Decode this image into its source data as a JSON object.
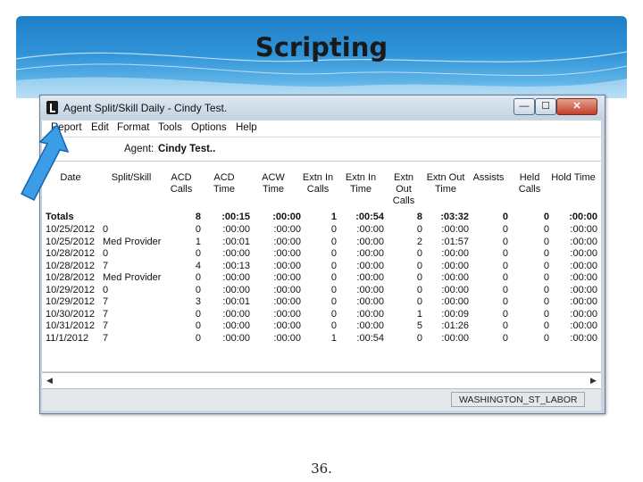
{
  "slide": {
    "title": "Scripting",
    "page_number": "36."
  },
  "window": {
    "title": "Agent Split/Skill Daily - Cindy Test.",
    "buttons": {
      "minimize": "—",
      "maximize": "☐",
      "close": "✕"
    }
  },
  "menu": [
    "Report",
    "Edit",
    "Format",
    "Tools",
    "Options",
    "Help"
  ],
  "agent": {
    "label": "Agent:",
    "value": "Cindy Test.."
  },
  "table": {
    "columns": [
      "Date",
      "Split/Skill",
      "ACD\nCalls",
      "ACD\nTime",
      "ACW\nTime",
      "Extn In\nCalls",
      "Extn In\nTime",
      "Extn\nOut\nCalls",
      "Extn Out\nTime",
      "Assists",
      "Held\nCalls",
      "Hold Time"
    ],
    "totals": [
      "Totals",
      "",
      "8",
      ":00:15",
      ":00:00",
      "1",
      ":00:54",
      "8",
      ":03:32",
      "0",
      "0",
      ":00:00"
    ],
    "rows": [
      [
        "10/25/2012",
        "0",
        "0",
        ":00:00",
        ":00:00",
        "0",
        ":00:00",
        "0",
        ":00:00",
        "0",
        "0",
        ":00:00"
      ],
      [
        "10/25/2012",
        "Med Provider",
        "1",
        ":00:01",
        ":00:00",
        "0",
        ":00:00",
        "2",
        ":01:57",
        "0",
        "0",
        ":00:00"
      ],
      [
        "10/28/2012",
        "0",
        "0",
        ":00:00",
        ":00:00",
        "0",
        ":00:00",
        "0",
        ":00:00",
        "0",
        "0",
        ":00:00"
      ],
      [
        "10/28/2012",
        "7",
        "4",
        ":00:13",
        ":00:00",
        "0",
        ":00:00",
        "0",
        ":00:00",
        "0",
        "0",
        ":00:00"
      ],
      [
        "10/28/2012",
        "Med Provider",
        "0",
        ":00:00",
        ":00:00",
        "0",
        ":00:00",
        "0",
        ":00:00",
        "0",
        "0",
        ":00:00"
      ],
      [
        "10/29/2012",
        "0",
        "0",
        ":00:00",
        ":00:00",
        "0",
        ":00:00",
        "0",
        ":00:00",
        "0",
        "0",
        ":00:00"
      ],
      [
        "10/29/2012",
        "7",
        "3",
        ":00:01",
        ":00:00",
        "0",
        ":00:00",
        "0",
        ":00:00",
        "0",
        "0",
        ":00:00"
      ],
      [
        "10/30/2012",
        "7",
        "0",
        ":00:00",
        ":00:00",
        "0",
        ":00:00",
        "1",
        ":00:09",
        "0",
        "0",
        ":00:00"
      ],
      [
        "10/31/2012",
        "7",
        "0",
        ":00:00",
        ":00:00",
        "0",
        ":00:00",
        "5",
        ":01:26",
        "0",
        "0",
        ":00:00"
      ],
      [
        "11/1/2012",
        "7",
        "0",
        ":00:00",
        ":00:00",
        "1",
        ":00:54",
        "0",
        ":00:00",
        "0",
        "0",
        ":00:00"
      ]
    ]
  },
  "scrollbar": {
    "left_arrow": "◀",
    "right_arrow": "▶"
  },
  "status": {
    "server": "WASHINGTON_ST_LABOR"
  },
  "colors": {
    "header_band": "#2f93d8",
    "annotation_arrow": "#3a9de6",
    "close_button": "#c0402a"
  }
}
